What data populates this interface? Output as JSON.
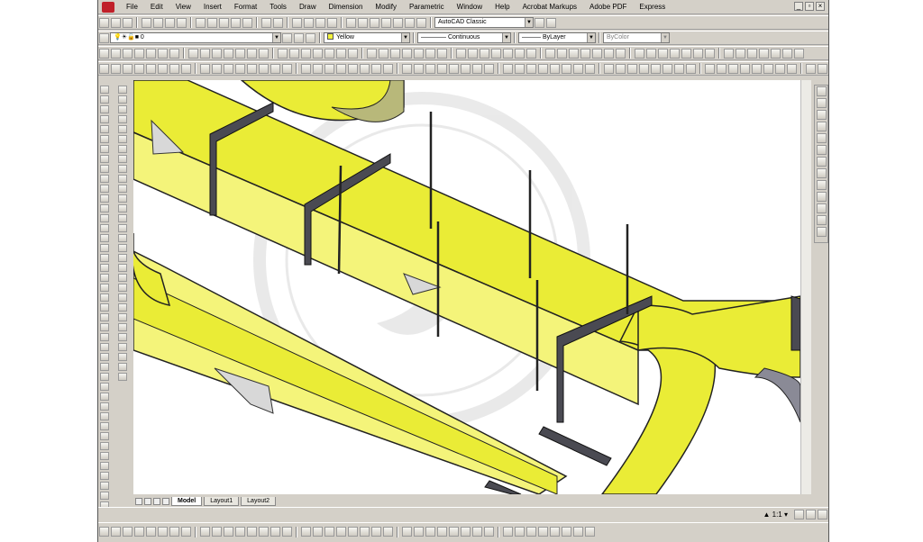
{
  "menu": {
    "items": [
      "File",
      "Edit",
      "View",
      "Insert",
      "Format",
      "Tools",
      "Draw",
      "Dimension",
      "Modify",
      "Parametric",
      "Window",
      "Help",
      "Acrobat Markups",
      "Adobe PDF",
      "Express"
    ]
  },
  "standard_toolbar": {
    "workspace": "AutoCAD Classic"
  },
  "layers_toolbar": {
    "layer": "0"
  },
  "properties_toolbar": {
    "color": "Yellow",
    "linetype": "Continuous",
    "lineweight": "ByLayer",
    "plotstyle": "ByColor"
  },
  "layout_tabs": [
    "Model",
    "Layout1",
    "Layout2"
  ],
  "status": {
    "annotation_scale": "1:1"
  },
  "colors": {
    "duct": "#eaec36",
    "flange": "#4a4a52",
    "background": "#d4d0c8"
  }
}
